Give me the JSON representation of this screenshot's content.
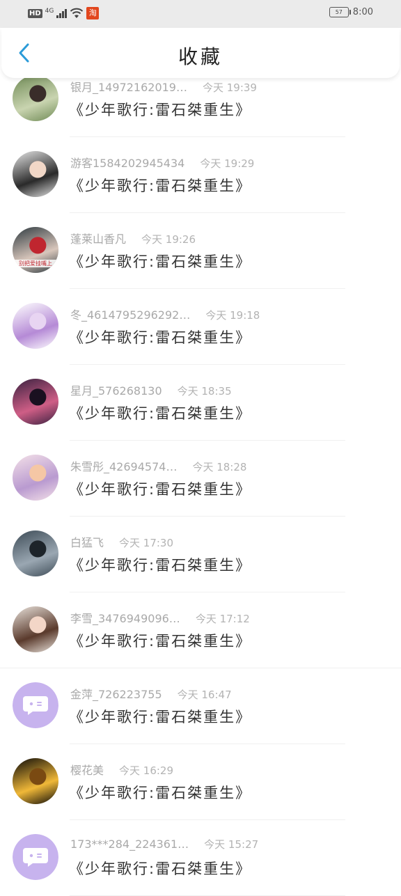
{
  "status_bar": {
    "network_badge": "HD",
    "network_type": "4G",
    "app_badge": "淘",
    "battery_level": "57",
    "time": "8:00"
  },
  "header": {
    "title": "收藏",
    "back_icon": "chevron-left-icon"
  },
  "items": [
    {
      "user": "银月_14972162019…",
      "time": "今天 19:39",
      "title": "《少年歌行:雷石桀重生》",
      "avatar_colors": [
        "#6f8a55",
        "#c9d4b0",
        "#3a2d2a"
      ]
    },
    {
      "user": "游客1584202945434",
      "time": "今天 19:29",
      "title": "《少年歌行:雷石桀重生》",
      "avatar_colors": [
        "#e6e6e6",
        "#2a2a2a",
        "#f1d7c7"
      ]
    },
    {
      "user": "蓬莱山香凡",
      "time": "今天 19:26",
      "title": "《少年歌行:雷石桀重生》",
      "avatar_colors": [
        "#2e3a40",
        "#d8c6bb",
        "#c0262f"
      ],
      "avatar_text": "别把爱挂嘴上"
    },
    {
      "user": "冬_4614795296292…",
      "time": "今天 19:18",
      "title": "《少年歌行:雷石桀重生》",
      "avatar_colors": [
        "#ffffff",
        "#b58ad6",
        "#e8d5f2"
      ]
    },
    {
      "user": "星月_576268130",
      "time": "今天 18:35",
      "title": "《少年歌行:雷石桀重生》",
      "avatar_colors": [
        "#3a2140",
        "#cf5e86",
        "#1a1020"
      ]
    },
    {
      "user": "朱雪彤_42694574…",
      "time": "今天 18:28",
      "title": "《少年歌行:雷石桀重生》",
      "avatar_colors": [
        "#f4e1e8",
        "#b99ad0",
        "#f5c7a5"
      ]
    },
    {
      "user": "白猛飞",
      "time": "今天 17:30",
      "title": "《少年歌行:雷石桀重生》",
      "avatar_colors": [
        "#3d4b56",
        "#9aa7b2",
        "#1d242a"
      ]
    },
    {
      "user": "李雪_3476949096…",
      "time": "今天 17:12",
      "title": "《少年歌行:雷石桀重生》",
      "avatar_colors": [
        "#e9e2db",
        "#5a3a2c",
        "#f3d6c7"
      ]
    },
    {
      "user": "金萍_726223755",
      "time": "今天 16:47",
      "title": "《少年歌行:雷石桀重生》",
      "avatar_type": "bot"
    },
    {
      "user": "樱花美",
      "time": "今天 16:29",
      "title": "《少年歌行:雷石桀重生》",
      "avatar_colors": [
        "#0c0a08",
        "#f0b838",
        "#7a4a12"
      ]
    },
    {
      "user": "173***284_224361…",
      "time": "今天 15:27",
      "title": "《少年歌行:雷石桀重生》",
      "avatar_type": "bot"
    }
  ]
}
